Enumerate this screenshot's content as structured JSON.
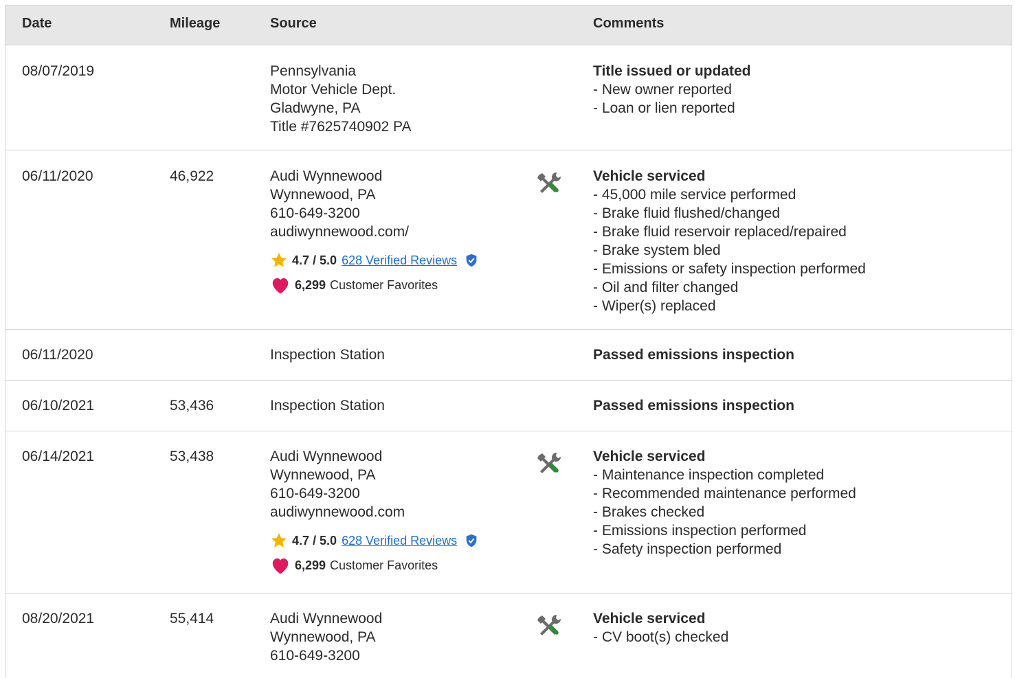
{
  "columns": {
    "date": "Date",
    "mileage": "Mileage",
    "source": "Source",
    "comments": "Comments"
  },
  "colors": {
    "header_bg": "#e7e7e7",
    "link": "#1e6fd1",
    "star": "#f5b400",
    "heart": "#e0185e",
    "verified": "#2b6fd6",
    "tool_gray": "#6b6b6b",
    "tool_green": "#2e8b3a"
  },
  "rows": [
    {
      "date": "08/07/2019",
      "mileage": "",
      "source": [
        "Pennsylvania",
        "Motor Vehicle Dept.",
        "Gladwyne, PA",
        "Title #7625740902 PA"
      ],
      "comment_title": "Title issued or updated",
      "comment_items": [
        "New owner reported",
        "Loan or lien reported"
      ]
    },
    {
      "date": "06/11/2020",
      "mileage": "46,922",
      "source": [
        "Audi Wynnewood",
        "Wynnewood, PA",
        "610-649-3200",
        "audiwynnewood.com/"
      ],
      "icon": "service-tools-icon",
      "rating": {
        "score": "4.7 / 5.0",
        "reviews_link": "628 Verified Reviews"
      },
      "favorites": {
        "count": "6,299",
        "label": "Customer Favorites"
      },
      "comment_title": "Vehicle serviced",
      "comment_items": [
        "45,000 mile service performed",
        "Brake fluid flushed/changed",
        "Brake fluid reservoir replaced/repaired",
        "Brake system bled",
        "Emissions or safety inspection performed",
        "Oil and filter changed",
        "Wiper(s) replaced"
      ]
    },
    {
      "date": "06/11/2020",
      "mileage": "",
      "source": [
        "Inspection Station"
      ],
      "comment_title": "Passed emissions inspection",
      "comment_items": []
    },
    {
      "date": "06/10/2021",
      "mileage": "53,436",
      "source": [
        "Inspection Station"
      ],
      "comment_title": "Passed emissions inspection",
      "comment_items": []
    },
    {
      "date": "06/14/2021",
      "mileage": "53,438",
      "source": [
        "Audi Wynnewood",
        "Wynnewood, PA",
        "610-649-3200",
        "audiwynnewood.com"
      ],
      "icon": "service-tools-icon",
      "rating": {
        "score": "4.7 / 5.0",
        "reviews_link": "628 Verified Reviews"
      },
      "favorites": {
        "count": "6,299",
        "label": "Customer Favorites"
      },
      "comment_title": "Vehicle serviced",
      "comment_items": [
        "Maintenance inspection completed",
        "Recommended maintenance performed",
        "Brakes checked",
        "Emissions inspection performed",
        "Safety inspection performed"
      ]
    },
    {
      "date": "08/20/2021",
      "mileage": "55,414",
      "source": [
        "Audi Wynnewood",
        "Wynnewood, PA",
        "610-649-3200"
      ],
      "icon": "service-tools-icon",
      "comment_title": "Vehicle serviced",
      "comment_items": [
        "CV boot(s) checked"
      ]
    }
  ]
}
